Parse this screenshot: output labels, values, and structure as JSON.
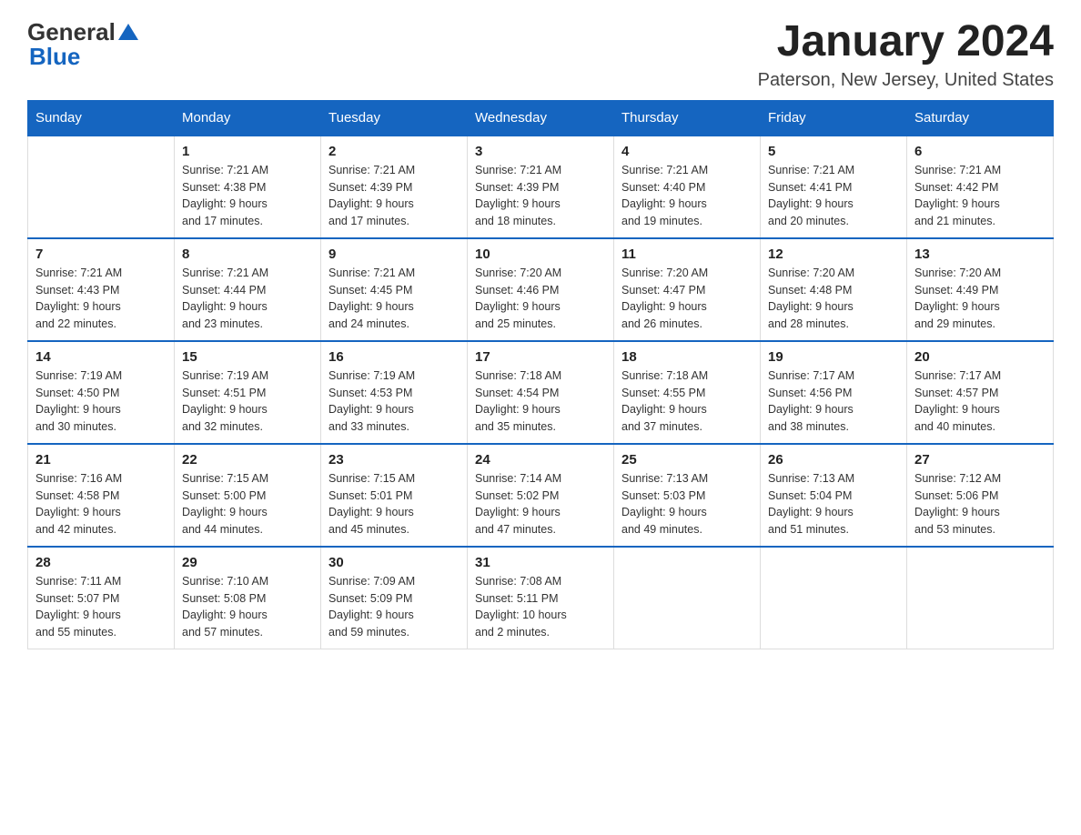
{
  "header": {
    "logo": {
      "general": "General",
      "blue": "Blue",
      "icon": "▲"
    },
    "title": "January 2024",
    "location": "Paterson, New Jersey, United States"
  },
  "weekdays": [
    "Sunday",
    "Monday",
    "Tuesday",
    "Wednesday",
    "Thursday",
    "Friday",
    "Saturday"
  ],
  "weeks": [
    [
      {
        "day": "",
        "info": ""
      },
      {
        "day": "1",
        "info": "Sunrise: 7:21 AM\nSunset: 4:38 PM\nDaylight: 9 hours\nand 17 minutes."
      },
      {
        "day": "2",
        "info": "Sunrise: 7:21 AM\nSunset: 4:39 PM\nDaylight: 9 hours\nand 17 minutes."
      },
      {
        "day": "3",
        "info": "Sunrise: 7:21 AM\nSunset: 4:39 PM\nDaylight: 9 hours\nand 18 minutes."
      },
      {
        "day": "4",
        "info": "Sunrise: 7:21 AM\nSunset: 4:40 PM\nDaylight: 9 hours\nand 19 minutes."
      },
      {
        "day": "5",
        "info": "Sunrise: 7:21 AM\nSunset: 4:41 PM\nDaylight: 9 hours\nand 20 minutes."
      },
      {
        "day": "6",
        "info": "Sunrise: 7:21 AM\nSunset: 4:42 PM\nDaylight: 9 hours\nand 21 minutes."
      }
    ],
    [
      {
        "day": "7",
        "info": "Sunrise: 7:21 AM\nSunset: 4:43 PM\nDaylight: 9 hours\nand 22 minutes."
      },
      {
        "day": "8",
        "info": "Sunrise: 7:21 AM\nSunset: 4:44 PM\nDaylight: 9 hours\nand 23 minutes."
      },
      {
        "day": "9",
        "info": "Sunrise: 7:21 AM\nSunset: 4:45 PM\nDaylight: 9 hours\nand 24 minutes."
      },
      {
        "day": "10",
        "info": "Sunrise: 7:20 AM\nSunset: 4:46 PM\nDaylight: 9 hours\nand 25 minutes."
      },
      {
        "day": "11",
        "info": "Sunrise: 7:20 AM\nSunset: 4:47 PM\nDaylight: 9 hours\nand 26 minutes."
      },
      {
        "day": "12",
        "info": "Sunrise: 7:20 AM\nSunset: 4:48 PM\nDaylight: 9 hours\nand 28 minutes."
      },
      {
        "day": "13",
        "info": "Sunrise: 7:20 AM\nSunset: 4:49 PM\nDaylight: 9 hours\nand 29 minutes."
      }
    ],
    [
      {
        "day": "14",
        "info": "Sunrise: 7:19 AM\nSunset: 4:50 PM\nDaylight: 9 hours\nand 30 minutes."
      },
      {
        "day": "15",
        "info": "Sunrise: 7:19 AM\nSunset: 4:51 PM\nDaylight: 9 hours\nand 32 minutes."
      },
      {
        "day": "16",
        "info": "Sunrise: 7:19 AM\nSunset: 4:53 PM\nDaylight: 9 hours\nand 33 minutes."
      },
      {
        "day": "17",
        "info": "Sunrise: 7:18 AM\nSunset: 4:54 PM\nDaylight: 9 hours\nand 35 minutes."
      },
      {
        "day": "18",
        "info": "Sunrise: 7:18 AM\nSunset: 4:55 PM\nDaylight: 9 hours\nand 37 minutes."
      },
      {
        "day": "19",
        "info": "Sunrise: 7:17 AM\nSunset: 4:56 PM\nDaylight: 9 hours\nand 38 minutes."
      },
      {
        "day": "20",
        "info": "Sunrise: 7:17 AM\nSunset: 4:57 PM\nDaylight: 9 hours\nand 40 minutes."
      }
    ],
    [
      {
        "day": "21",
        "info": "Sunrise: 7:16 AM\nSunset: 4:58 PM\nDaylight: 9 hours\nand 42 minutes."
      },
      {
        "day": "22",
        "info": "Sunrise: 7:15 AM\nSunset: 5:00 PM\nDaylight: 9 hours\nand 44 minutes."
      },
      {
        "day": "23",
        "info": "Sunrise: 7:15 AM\nSunset: 5:01 PM\nDaylight: 9 hours\nand 45 minutes."
      },
      {
        "day": "24",
        "info": "Sunrise: 7:14 AM\nSunset: 5:02 PM\nDaylight: 9 hours\nand 47 minutes."
      },
      {
        "day": "25",
        "info": "Sunrise: 7:13 AM\nSunset: 5:03 PM\nDaylight: 9 hours\nand 49 minutes."
      },
      {
        "day": "26",
        "info": "Sunrise: 7:13 AM\nSunset: 5:04 PM\nDaylight: 9 hours\nand 51 minutes."
      },
      {
        "day": "27",
        "info": "Sunrise: 7:12 AM\nSunset: 5:06 PM\nDaylight: 9 hours\nand 53 minutes."
      }
    ],
    [
      {
        "day": "28",
        "info": "Sunrise: 7:11 AM\nSunset: 5:07 PM\nDaylight: 9 hours\nand 55 minutes."
      },
      {
        "day": "29",
        "info": "Sunrise: 7:10 AM\nSunset: 5:08 PM\nDaylight: 9 hours\nand 57 minutes."
      },
      {
        "day": "30",
        "info": "Sunrise: 7:09 AM\nSunset: 5:09 PM\nDaylight: 9 hours\nand 59 minutes."
      },
      {
        "day": "31",
        "info": "Sunrise: 7:08 AM\nSunset: 5:11 PM\nDaylight: 10 hours\nand 2 minutes."
      },
      {
        "day": "",
        "info": ""
      },
      {
        "day": "",
        "info": ""
      },
      {
        "day": "",
        "info": ""
      }
    ]
  ]
}
